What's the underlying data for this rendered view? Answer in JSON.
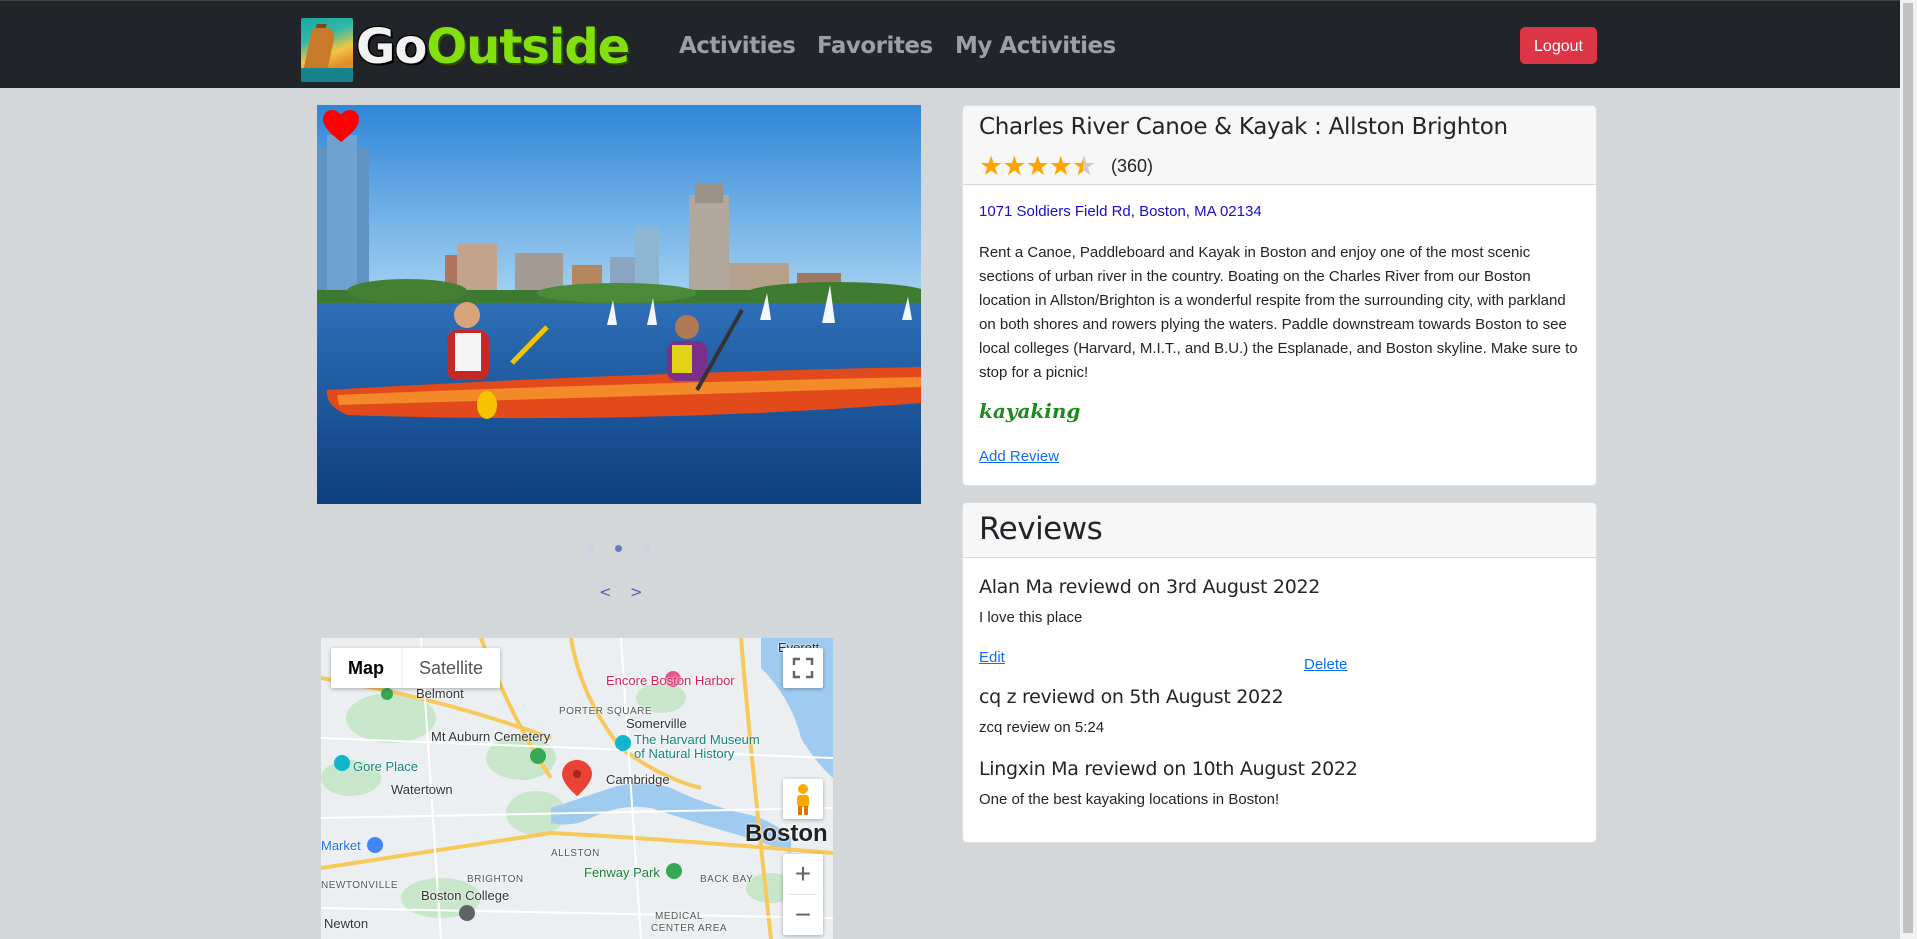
{
  "nav": {
    "brand_go": "Go",
    "brand_outside": "Outside",
    "links": [
      "Activities",
      "Favorites",
      "My Activities"
    ],
    "logout": "Logout"
  },
  "carousel": {
    "favorited": true,
    "slide_count": 3,
    "active_slide": 2,
    "prev": "<",
    "next": ">"
  },
  "map": {
    "type_map": "Map",
    "type_satellite": "Satellite",
    "zoom_in": "+",
    "zoom_out": "−",
    "labels": {
      "everett": "Everett",
      "encore": "Encore Boston Harbor",
      "belmont": "Belmont",
      "porter": "PORTER SQUARE",
      "somerville": "Somerville",
      "mt_auburn": "Mt Auburn Cemetery",
      "harvard_museum_1": "The Harvard Museum",
      "harvard_museum_2": "of Natural History",
      "gore": "Gore Place",
      "cambridge": "Cambridge",
      "watertown": "Watertown",
      "boston": "Boston",
      "market": "Market",
      "allston": "ALLSTON",
      "brighton": "BRIGHTON",
      "fenway": "Fenway Park",
      "back_bay": "BACK BAY",
      "newtonville": "NEWTONVILLE",
      "boston_college": "Boston College",
      "newton": "Newton",
      "medical_1": "MEDICAL",
      "medical_2": "CENTER AREA"
    }
  },
  "activity": {
    "title": "Charles River Canoe & Kayak : Allston Brighton",
    "rating": 4.5,
    "rating_count": "(360)",
    "address": "1071 Soldiers Field Rd, Boston, MA 02134",
    "description": "Rent a Canoe, Paddleboard and Kayak in Boston and enjoy one of the most scenic sections of urban river in the country. Boating on the Charles River from our Boston location in Allston/Brighton is a wonderful respite from the surrounding city, with parkland on both shores and rowers plying the waters. Paddle downstream towards Boston to see local colleges (Harvard, M.I.T., and B.U.) the Esplanade, and Boston skyline. Make sure to stop for a picnic!",
    "tag": "kayaking",
    "add_review": "Add Review"
  },
  "reviews": {
    "heading": "Reviews",
    "edit": "Edit",
    "delete": "Delete",
    "items": [
      {
        "header": "Alan Ma reviewd on 3rd August 2022",
        "body": "I love this place"
      },
      {
        "header": "cq z reviewd on 5th August 2022",
        "body": "zcq review on 5:24"
      },
      {
        "header": "Lingxin Ma reviewd on 10th August 2022",
        "body": "One of the best kayaking locations in Boston!"
      }
    ]
  },
  "colors": {
    "navbar": "#212529",
    "logout": "#dc3545",
    "link": "#0d6efd",
    "star": "#ffa500",
    "tag": "#1e8a1e",
    "heart": "#ff0000"
  }
}
